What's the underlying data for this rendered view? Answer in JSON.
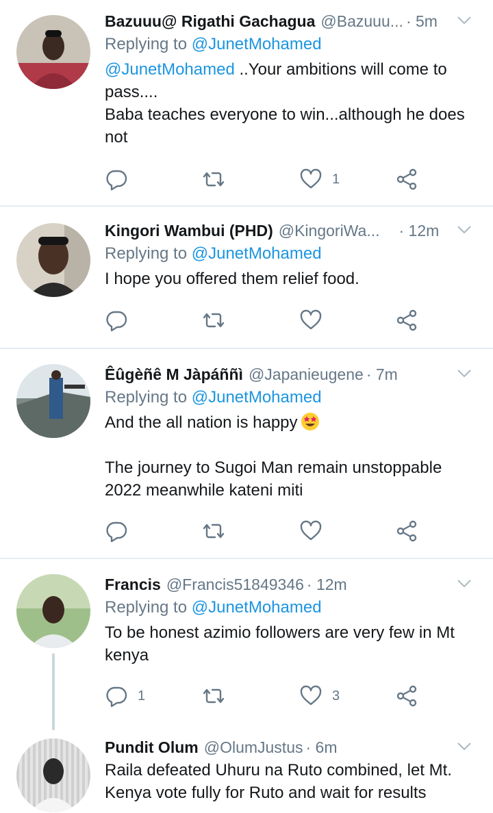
{
  "tweets": [
    {
      "name": "Bazuuu@ Rigathi Gachagua",
      "handle": "@Bazuuu...",
      "time": "· 5m",
      "replying_prefix": "Replying to",
      "replying_to": "@JunetMohamed",
      "mention": "@JunetMohamed",
      "text_lines": [
        " ..Your ambitions will come to",
        "pass....",
        "Baba teaches everyone to win...although he does",
        "not"
      ],
      "reply_count": "",
      "retweet_count": "",
      "like_count": "1"
    },
    {
      "name": "Kingori Wambui (PHD)",
      "handle": "@KingoriWa...",
      "time": "· 12m",
      "replying_prefix": "Replying to",
      "replying_to": "@JunetMohamed",
      "text_lines": [
        "I hope you offered them relief food."
      ],
      "reply_count": "",
      "retweet_count": "",
      "like_count": ""
    },
    {
      "name": "Êûgèñê M Jàpáññì",
      "handle": "@Japanieugene",
      "time": "· 7m",
      "replying_prefix": "Replying to",
      "replying_to": "@JunetMohamed",
      "text_lines": [
        "And the all nation is happy",
        "",
        "The journey to Sugoi Man remain unstoppable",
        "2022 meanwhile kateni miti"
      ],
      "reply_count": "",
      "retweet_count": "",
      "like_count": ""
    },
    {
      "name": "Francis",
      "handle": "@Francis51849346",
      "time": "· 12m",
      "replying_prefix": "Replying to",
      "replying_to": "@JunetMohamed",
      "text_lines": [
        "To be honest azimio followers are very few in Mt",
        "kenya"
      ],
      "reply_count": "1",
      "retweet_count": "",
      "like_count": "3"
    },
    {
      "name": "Pundit Olum",
      "handle": "@OlumJustus",
      "time": "· 6m",
      "text_lines": [
        "Raila defeated Uhuru na Ruto combined, let Mt.",
        "Kenya vote fully for Ruto and wait for results"
      ]
    }
  ],
  "icons": {
    "reply": "reply-icon",
    "retweet": "retweet-icon",
    "like": "heart-icon",
    "share": "share-icon",
    "caret": "chevron-down-icon",
    "emoji": "star-struck-emoji"
  },
  "colors": {
    "link": "#1b95e0",
    "muted": "#657786",
    "text": "#14171a",
    "divider": "#e6ecf0"
  }
}
